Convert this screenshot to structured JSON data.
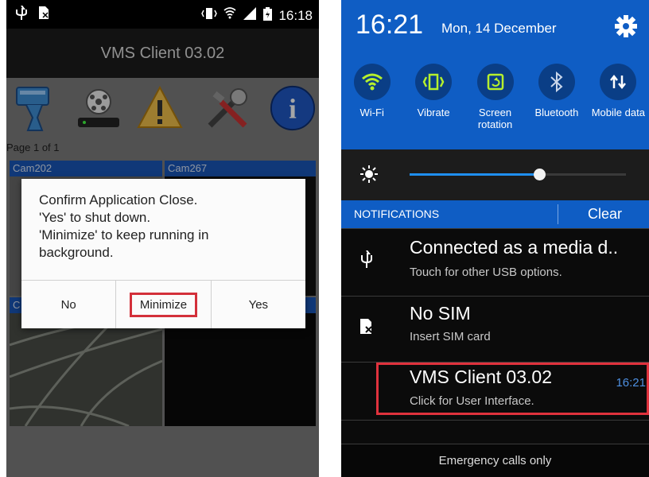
{
  "left": {
    "status_bar": {
      "time": "16:18"
    },
    "app_title": "VMS Client 03.02",
    "page_label": "Page 1 of 1",
    "cameras": [
      "Cam202",
      "Cam267",
      "C",
      ""
    ],
    "dialog": {
      "message_lines": [
        "Confirm Application Close.",
        "'Yes' to shut down.",
        "'Minimize' to keep running in",
        "background."
      ],
      "buttons": {
        "no": "No",
        "minimize": "Minimize",
        "yes": "Yes"
      }
    },
    "toolbar_icons": [
      "camera-icon",
      "recorder-icon",
      "warning-icon",
      "tools-icon",
      "info-icon"
    ]
  },
  "right": {
    "time": "16:21",
    "date": "Mon, 14 December",
    "quick_settings": [
      {
        "label": "Wi-Fi",
        "icon": "wifi-icon"
      },
      {
        "label": "Vibrate",
        "icon": "vibrate-icon"
      },
      {
        "label": "Screen rotation",
        "icon": "rotation-icon"
      },
      {
        "label": "Bluetooth",
        "icon": "bluetooth-icon"
      },
      {
        "label": "Mobile data",
        "icon": "mobile-data-icon"
      }
    ],
    "brightness_level": 0.6,
    "notifications_header": "NOTIFICATIONS",
    "clear_label": "Clear",
    "notifications": [
      {
        "title": "Connected as a media d..",
        "subtitle": "Touch for other USB options.",
        "icon": "usb-icon"
      },
      {
        "title": "No SIM",
        "subtitle": "Insert SIM card",
        "icon": "no-sim-icon"
      },
      {
        "title": "VMS Client 03.02",
        "subtitle": "Click for User Interface.",
        "time": "16:21"
      }
    ],
    "footer": "Emergency calls only"
  },
  "colors": {
    "accent": "#0f5dc4",
    "highlight": "#e0323d",
    "cam_header": "#1a56b8"
  }
}
